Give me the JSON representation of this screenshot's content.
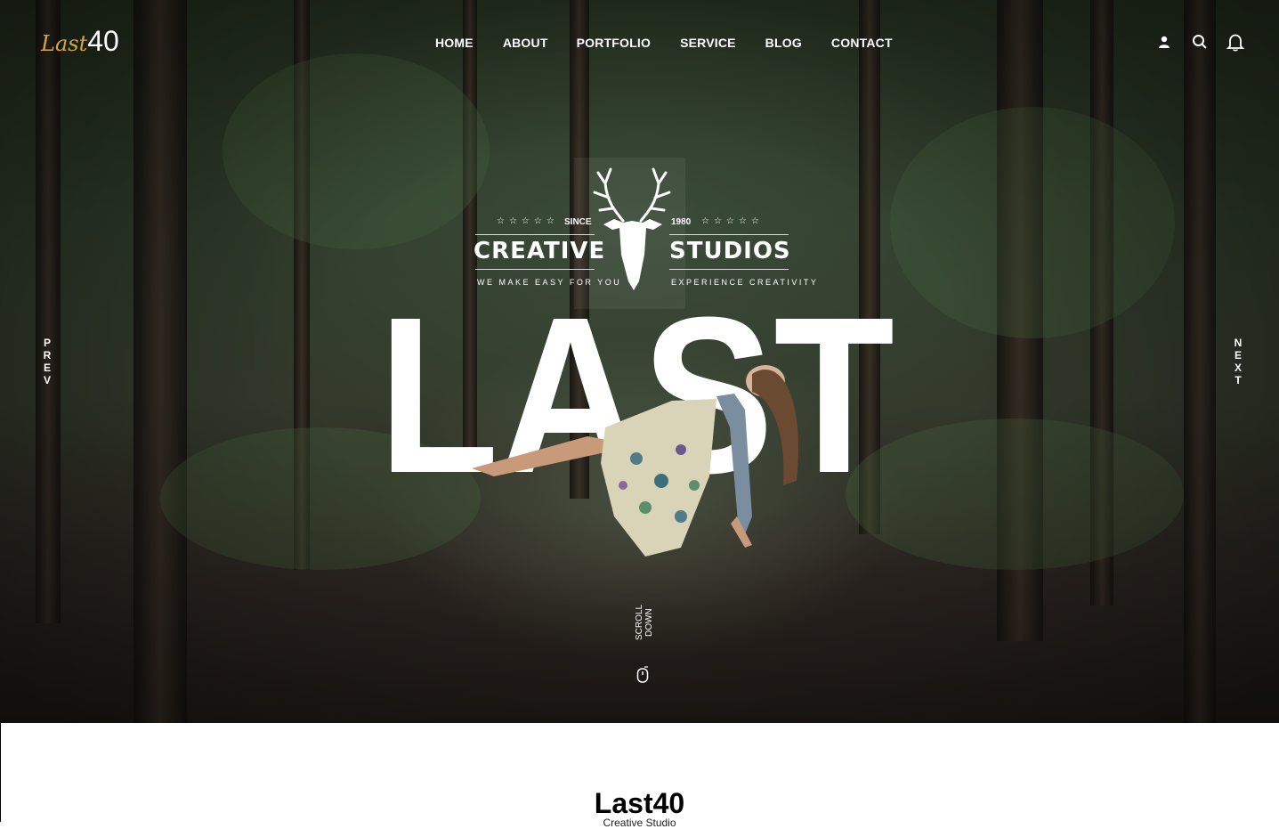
{
  "logo": {
    "script": "Last",
    "number": "40"
  },
  "nav": [
    {
      "label": "HOME"
    },
    {
      "label": "ABOUT"
    },
    {
      "label": "PORTFOLIO"
    },
    {
      "label": "SERVICE"
    },
    {
      "label": "BLOG"
    },
    {
      "label": "CONTACT"
    }
  ],
  "header_icons": [
    "user-icon",
    "search-icon",
    "bell-icon"
  ],
  "hero": {
    "prev_label": "PREV",
    "next_label": "NEXT",
    "big_word": "LAST",
    "scroll_label": "SCROLL DOWN",
    "badge": {
      "since": "SINCE",
      "year": "1980",
      "left_title": "CREATIVE",
      "right_title": "STUDIOS",
      "left_tagline": "WE MAKE EASY FOR YOU",
      "right_tagline": "EXPERIENCE CREATIVITY",
      "stars": "☆☆☆☆☆"
    }
  },
  "section": {
    "title": "Last40",
    "subtitle": "Creative Studio"
  },
  "colors": {
    "accent": "#d5a640",
    "text_light": "#ffffff",
    "text_dark": "#000000"
  }
}
